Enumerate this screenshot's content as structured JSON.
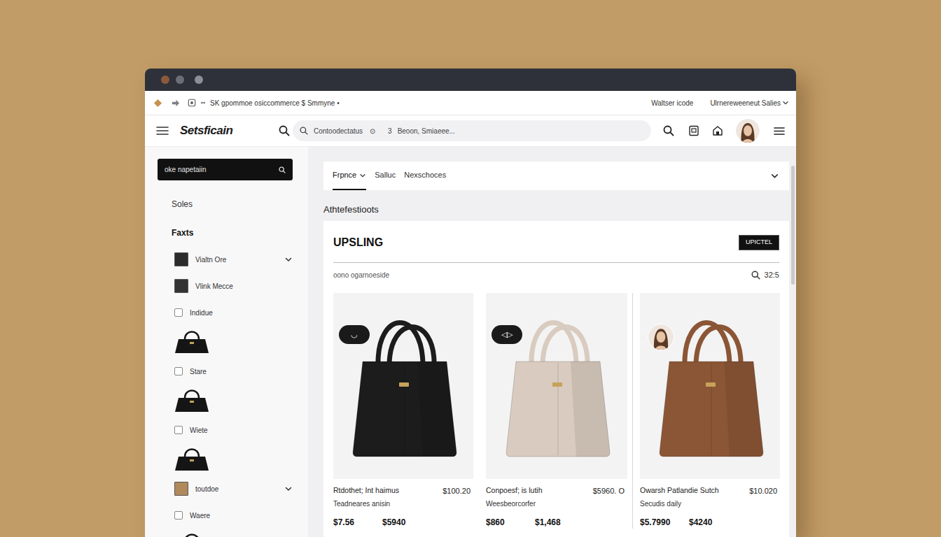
{
  "browser": {
    "address": "SK gpommoe osiccommerce $ Smmyne •",
    "links": [
      {
        "label": "Waltser icode",
        "kind": "plain"
      },
      {
        "label": "Ulrnereweeneut Salies",
        "kind": "dropdown"
      }
    ]
  },
  "nav": {
    "logo": "Setsficain",
    "search": [
      "Contoodectatus",
      "⊙",
      "3",
      "Beoon, Smiaeee..."
    ]
  },
  "sidebar": {
    "search": {
      "placeholder": "oke napetaiin"
    },
    "heading": "Soles",
    "section": "Faxts",
    "items": [
      {
        "kind": "dropdown",
        "label": "Vialtn Ore",
        "color": "#2b2b2b",
        "expanded": false
      },
      {
        "kind": "swatch",
        "label": "Vlink Mecce",
        "color": "#333333"
      },
      {
        "kind": "checkbox",
        "label": "Indidue",
        "checked": false
      },
      {
        "kind": "thumb",
        "color": "#151515"
      },
      {
        "kind": "checkbox",
        "label": "Stare",
        "checked": false
      },
      {
        "kind": "thumb",
        "color": "#151515"
      },
      {
        "kind": "checkbox",
        "label": "Wiete",
        "checked": false
      },
      {
        "kind": "thumb",
        "color": "#151515"
      },
      {
        "kind": "dropdown",
        "label": "toutdoe",
        "color": "#b08a5c",
        "expanded": false
      },
      {
        "kind": "checkbox",
        "label": "Waere",
        "checked": false
      },
      {
        "kind": "thumb",
        "color": "#151515"
      }
    ]
  },
  "tabs": [
    {
      "label": "Frpnce",
      "kind": "dropdown",
      "selected": true
    },
    {
      "label": "Salluc",
      "kind": "plain",
      "selected": false
    },
    {
      "label": "Nexschoces",
      "kind": "plain",
      "selected": false
    }
  ],
  "heading": "Athtefestioots",
  "card": {
    "title": "UPSLING",
    "button": "UPICTEL",
    "subtitle": "oono ogarnoeside",
    "count": "32:5",
    "products": [
      {
        "name": "Rtdothet; Int haimus",
        "price": "$100.20",
        "subtitle": "Teadneares anisin",
        "price_a": "$7.56",
        "price_b": "$5940",
        "kind": "badge",
        "badge": "◡",
        "color": "#1c1c1c"
      },
      {
        "name": "Conpoesf; is lutih",
        "price": "$5960. O",
        "subtitle": "Weesbeorcorfer",
        "price_a": "$860",
        "price_b": "$1,468",
        "kind": "badge",
        "badge": "◁▷",
        "color": "#d9cbbf"
      },
      {
        "name": "Owarsh Patlandie Sutch",
        "price": "$10.020",
        "subtitle": "Secudis daily",
        "price_a": "$5.7990",
        "price_b": "$4240",
        "kind": "avatar",
        "color": "#8b5636"
      }
    ]
  }
}
